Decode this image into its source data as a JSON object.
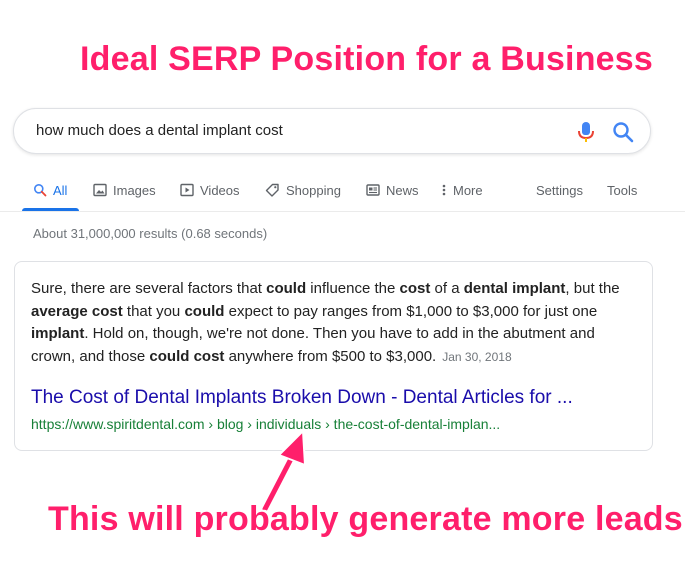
{
  "annotations": {
    "top": "Ideal SERP Position for a Business",
    "bottom": "This will probably generate more leads",
    "color": "#ff1f6b"
  },
  "search": {
    "query": "how much does a dental implant cost",
    "mic_icon": "mic-icon",
    "search_icon": "search-icon"
  },
  "tabs": [
    {
      "label": "All",
      "icon": "search-icon",
      "active": true
    },
    {
      "label": "Images",
      "icon": "image-icon"
    },
    {
      "label": "Videos",
      "icon": "video-icon"
    },
    {
      "label": "Shopping",
      "icon": "tag-icon"
    },
    {
      "label": "News",
      "icon": "news-icon"
    },
    {
      "label": "More",
      "icon": "more-vertical-icon"
    },
    {
      "label": "Settings"
    },
    {
      "label": "Tools"
    }
  ],
  "stats": "About 31,000,000 results (0.68 seconds)",
  "snippet": {
    "segments": [
      {
        "t": "Sure, there are several factors that "
      },
      {
        "t": "could",
        "b": true
      },
      {
        "t": " influence the "
      },
      {
        "t": "cost",
        "b": true
      },
      {
        "t": " of a "
      },
      {
        "t": "dental implant",
        "b": true
      },
      {
        "t": ", but the "
      },
      {
        "t": "average cost",
        "b": true
      },
      {
        "t": " that you "
      },
      {
        "t": "could",
        "b": true
      },
      {
        "t": " expect to pay ranges from $1,000 to $3,000 for just one "
      },
      {
        "t": "implant",
        "b": true
      },
      {
        "t": ". Hold on, though, we're not done. Then you have to add in the abutment and crown, and those "
      },
      {
        "t": "could cost",
        "b": true
      },
      {
        "t": " anywhere from $500 to $3,000."
      }
    ],
    "date": "Jan 30, 2018",
    "title": "The Cost of Dental Implants Broken Down - Dental Articles for ...",
    "url": "https://www.spiritdental.com › blog › individuals › the-cost-of-dental-implan..."
  },
  "colors": {
    "link": "#1a0dab",
    "url": "#188038",
    "accent": "#1a73e8"
  }
}
